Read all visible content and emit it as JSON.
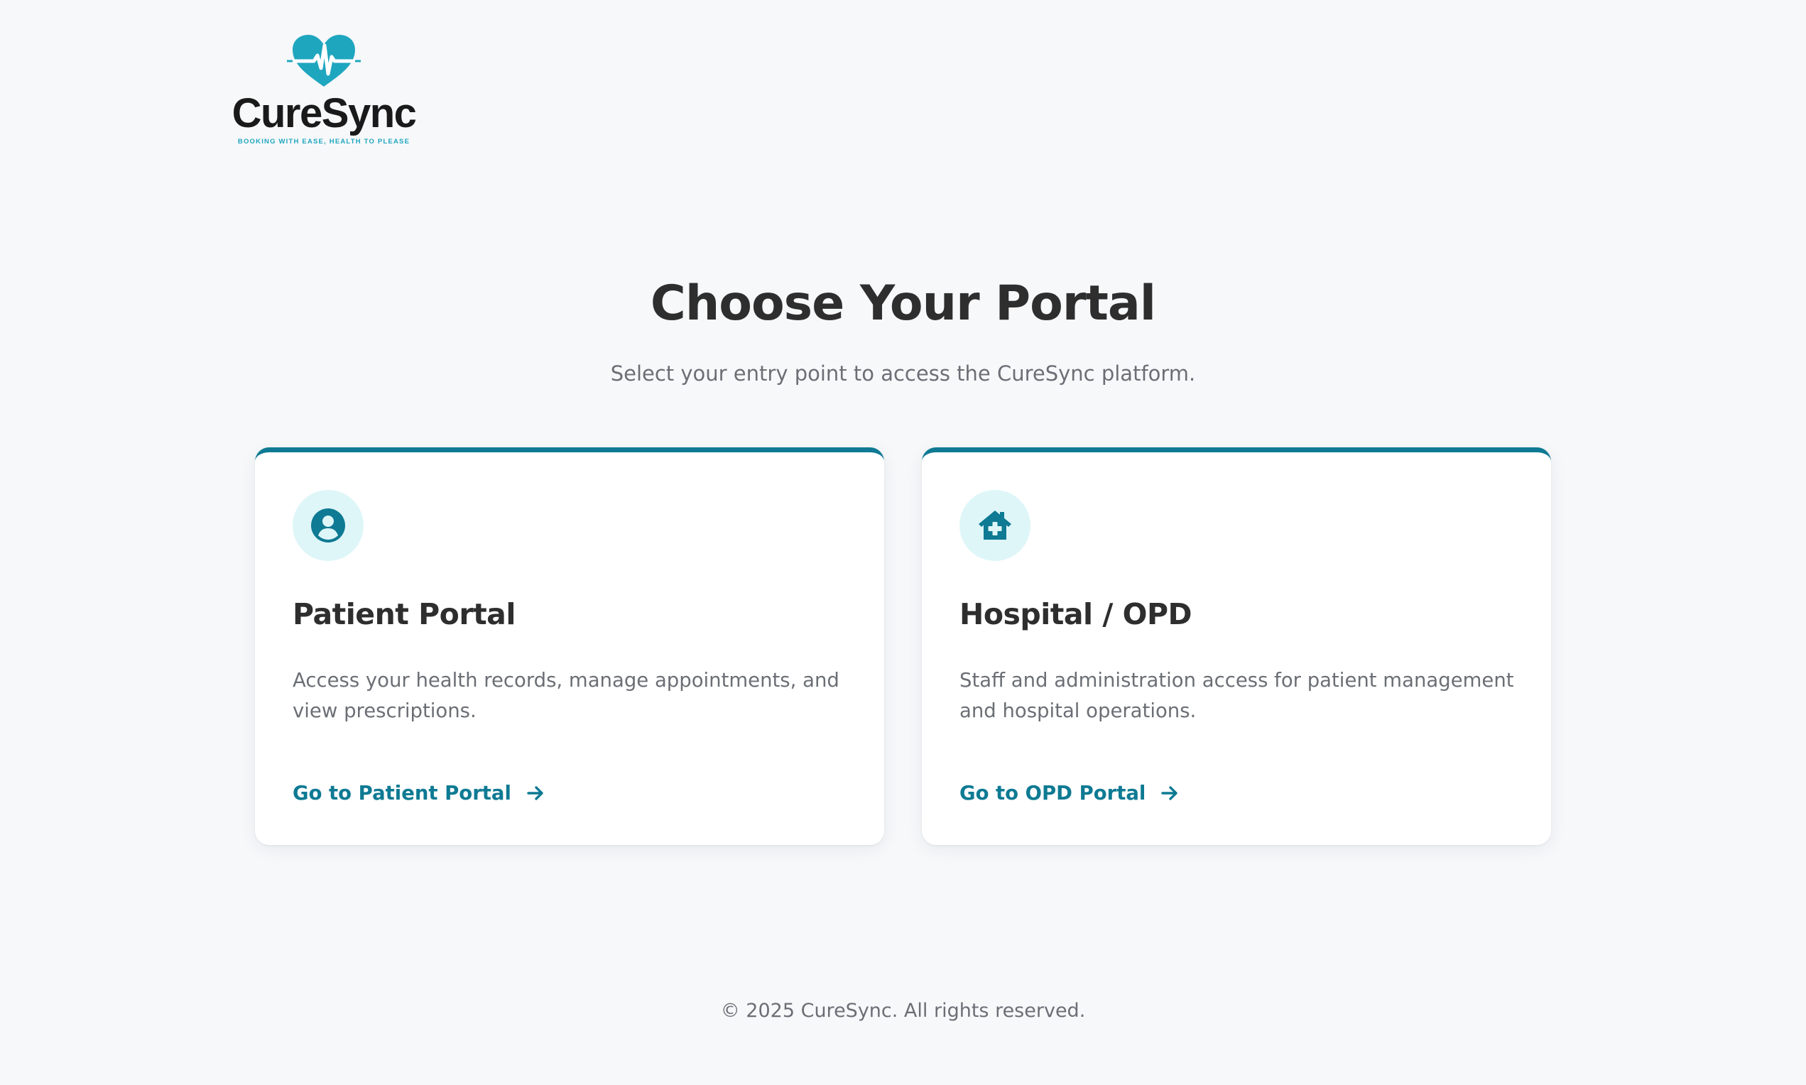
{
  "brand": {
    "name": "CureSync",
    "tagline": "BOOKING WITH EASE, HEALTH TO PLEASE",
    "logo_icon": "heart-pulse-icon",
    "accent_color": "#1fa6bf"
  },
  "hero": {
    "title": "Choose Your Portal",
    "subtitle": "Select your entry point to access the CureSync platform."
  },
  "portals": [
    {
      "icon": "user-circle-icon",
      "title": "Patient Portal",
      "description": "Access your health records, manage appointments, and view prescriptions.",
      "link_label": "Go to Patient Portal",
      "link_icon": "arrow-right-icon"
    },
    {
      "icon": "house-medical-icon",
      "title": "Hospital / OPD",
      "description": "Staff and administration access for patient management and hospital operations.",
      "link_label": "Go to OPD Portal",
      "link_icon": "arrow-right-icon"
    }
  ],
  "footer": {
    "copyright": "© 2025 CureSync. All rights reserved."
  },
  "colors": {
    "primary": "#0e7a93",
    "icon_bg": "#def6f8",
    "page_bg": "#f7f8fa"
  }
}
